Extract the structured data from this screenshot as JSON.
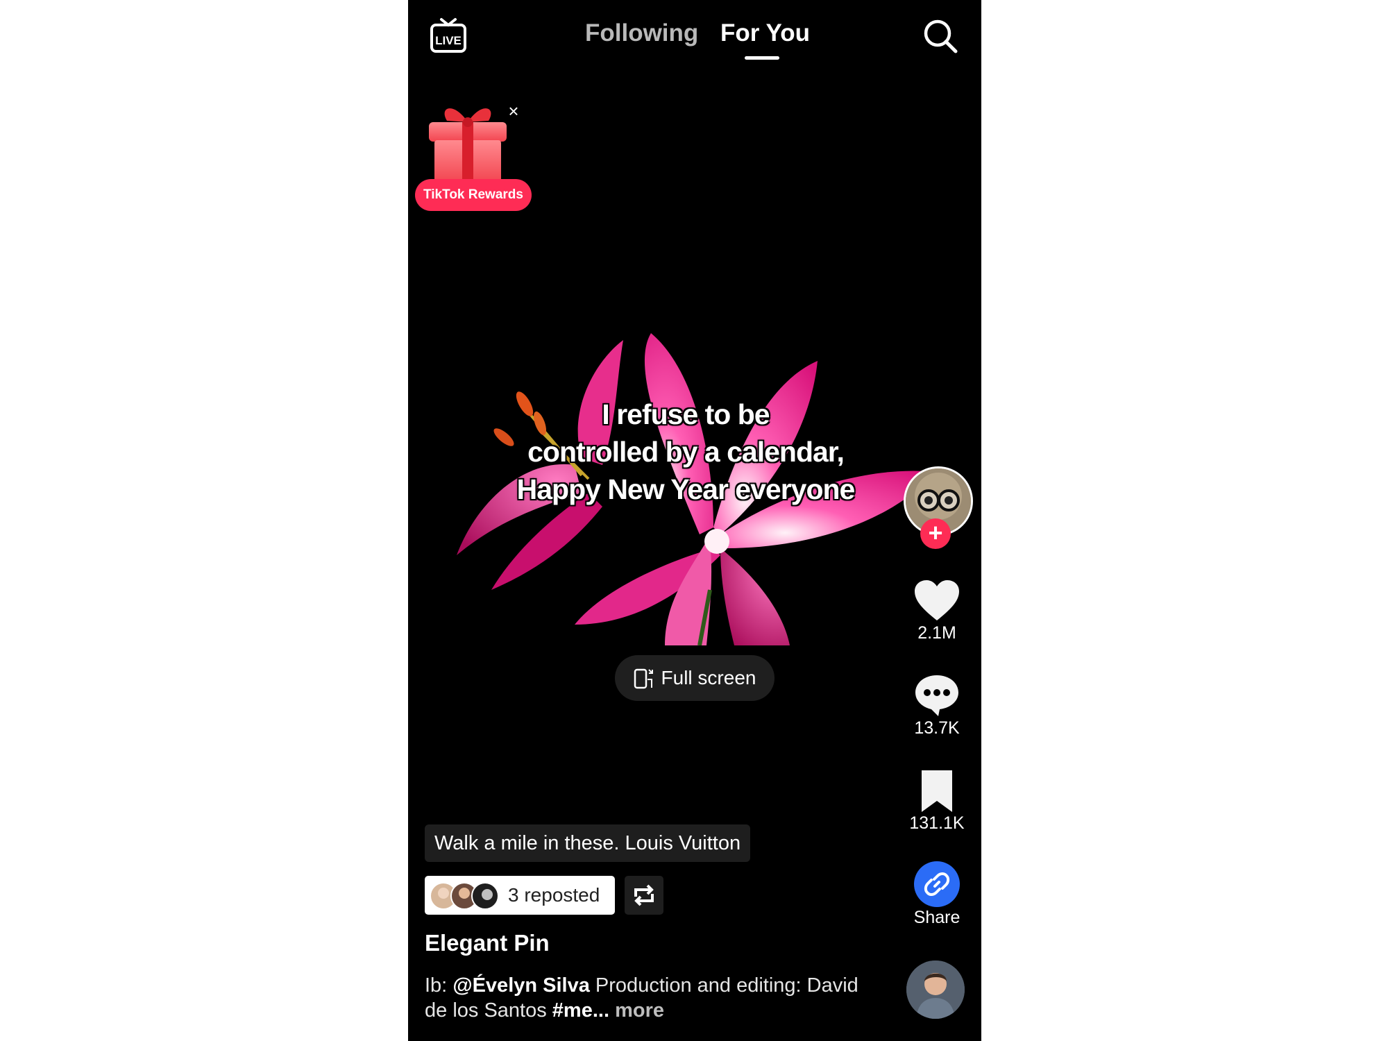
{
  "header": {
    "live_label": "LIVE",
    "tabs": [
      {
        "label": "Following",
        "active": false
      },
      {
        "label": "For You",
        "active": true
      }
    ],
    "search_icon": "search-icon"
  },
  "rewards": {
    "label": "TikTok Rewards",
    "close_glyph": "×",
    "icon": "gift-icon"
  },
  "video": {
    "caption_lines": [
      "I refuse to be",
      "controlled by a calendar,",
      "Happy New Year everyone"
    ],
    "full_screen_label": "Full screen"
  },
  "actions": {
    "likes": "2.1M",
    "comments": "13.7K",
    "saves": "131.1K",
    "share_label": "Share",
    "follow_glyph": "+"
  },
  "post": {
    "product_tag": "Walk a mile in these. Louis Vuitton",
    "reposted_label": "3 reposted",
    "username": "Elegant Pin",
    "description_prefix": "Ib: ",
    "description_mention": "@Évelyn Silva",
    "description_middle": "  Production and editing: David de los Santos ",
    "description_tag": "#me...",
    "description_more": " more"
  },
  "colors": {
    "background": "#000000",
    "accent_red": "#fe2c55",
    "share_blue": "#2b6cf6",
    "inactive_tab": "#b9b9b9"
  }
}
